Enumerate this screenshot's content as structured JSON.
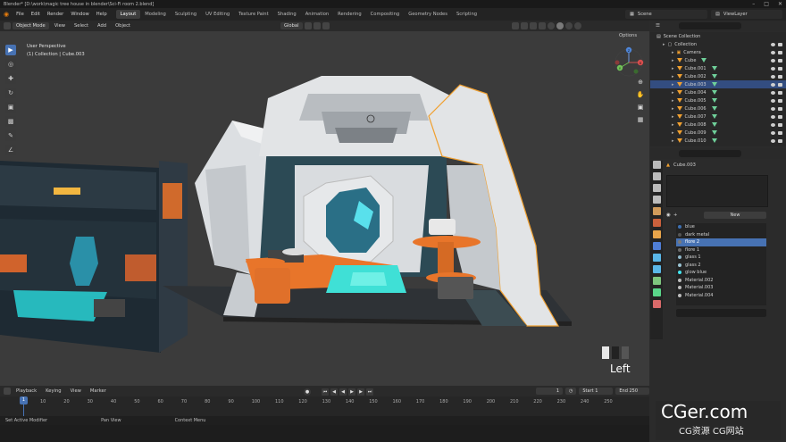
{
  "window": {
    "title": "Blender* [D:\\work\\magic tree house in blender\\Sci-Fi room 2.blend]"
  },
  "menu": {
    "items": [
      "File",
      "Edit",
      "Render",
      "Window",
      "Help"
    ],
    "workspaces": [
      "Layout",
      "Modeling",
      "Sculpting",
      "UV Editing",
      "Texture Paint",
      "Shading",
      "Animation",
      "Rendering",
      "Compositing",
      "Geometry Nodes",
      "Scripting"
    ],
    "active_workspace": "Layout",
    "scene_label": "Scene",
    "view_layer_label": "ViewLayer"
  },
  "viewport_header": {
    "mode": "Object Mode",
    "menus": [
      "View",
      "Select",
      "Add",
      "Object"
    ],
    "orientation": "Global",
    "options": "Options"
  },
  "viewport": {
    "perspective": "User Perspective",
    "collection_info": "(1) Collection | Cube.003",
    "view_label": "Left",
    "gizmo_axes": [
      "X",
      "Y",
      "Z"
    ]
  },
  "outliner": {
    "rows": [
      {
        "label": "Scene Collection",
        "indent": 0,
        "type": "scene"
      },
      {
        "label": "Collection",
        "indent": 1,
        "type": "collection"
      },
      {
        "label": "Camera",
        "indent": 2,
        "type": "camera"
      },
      {
        "label": "Cube",
        "indent": 2,
        "type": "mesh"
      },
      {
        "label": "Cube.001",
        "indent": 2,
        "type": "mesh"
      },
      {
        "label": "Cube.002",
        "indent": 2,
        "type": "mesh"
      },
      {
        "label": "Cube.003",
        "indent": 2,
        "type": "mesh",
        "selected": true
      },
      {
        "label": "Cube.004",
        "indent": 2,
        "type": "mesh"
      },
      {
        "label": "Cube.005",
        "indent": 2,
        "type": "mesh"
      },
      {
        "label": "Cube.006",
        "indent": 2,
        "type": "mesh"
      },
      {
        "label": "Cube.007",
        "indent": 2,
        "type": "mesh"
      },
      {
        "label": "Cube.008",
        "indent": 2,
        "type": "mesh"
      },
      {
        "label": "Cube.009",
        "indent": 2,
        "type": "mesh"
      },
      {
        "label": "Cube.010",
        "indent": 2,
        "type": "mesh"
      }
    ]
  },
  "properties": {
    "object_name": "Cube.003",
    "new_button": "New",
    "materials": [
      {
        "name": "blue",
        "color": "#3d6fb0"
      },
      {
        "name": "dark metal",
        "color": "#555555"
      },
      {
        "name": "flore 2",
        "color": "#7a7a7a",
        "selected": true
      },
      {
        "name": "flore 1",
        "color": "#6b6b6b"
      },
      {
        "name": "glass 1",
        "color": "#8fb7c9"
      },
      {
        "name": "glass 2",
        "color": "#9cc5d4"
      },
      {
        "name": "glow blue",
        "color": "#43e6f0"
      },
      {
        "name": "Material.002",
        "color": "#bdbdbd"
      },
      {
        "name": "Material.003",
        "color": "#bdbdbd"
      },
      {
        "name": "Material.004",
        "color": "#bdbdbd"
      }
    ]
  },
  "timeline": {
    "menus": [
      "Playback",
      "Keying",
      "View",
      "Marker"
    ],
    "current_frame": "1",
    "start_label": "Start",
    "start": "1",
    "end_label": "End",
    "end": "250",
    "ticks": [
      "10",
      "20",
      "30",
      "40",
      "50",
      "60",
      "70",
      "80",
      "90",
      "100",
      "110",
      "120",
      "130",
      "140",
      "150",
      "160",
      "170",
      "180",
      "190",
      "200",
      "210",
      "220",
      "230",
      "240",
      "250"
    ]
  },
  "statusbar": {
    "items": [
      "Set Active Modifier",
      "Pan View",
      "Context Menu"
    ]
  },
  "watermark": {
    "line1": "CGer.com",
    "line2": "CG资源 CG网站"
  },
  "colors": {
    "accent": "#4772b3",
    "selection": "#f0a030",
    "orange": "#e8752a",
    "cyan": "#3fe0d6"
  }
}
